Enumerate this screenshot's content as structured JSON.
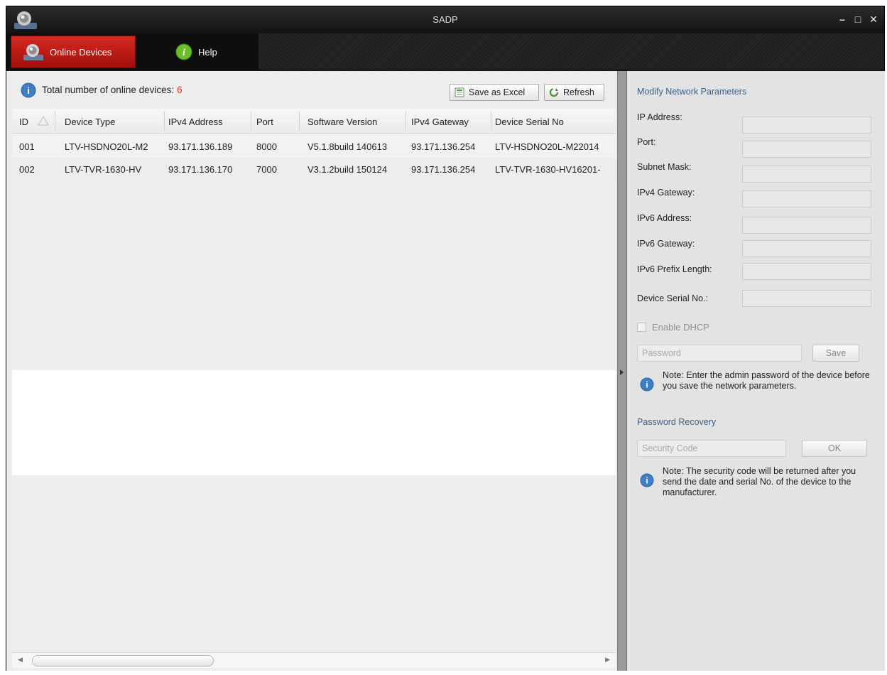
{
  "window": {
    "title": "SADP",
    "controls": {
      "minimize": "–",
      "maximize": "□",
      "close": "✕"
    }
  },
  "tabs": [
    {
      "label": "Online Devices",
      "icon": "camera-icon",
      "active": true
    },
    {
      "label": "Help",
      "icon": "info-icon",
      "active": false
    }
  ],
  "device_list": {
    "total_label": "Total number of online devices:",
    "total_count": "6",
    "buttons": {
      "save_excel": "Save as Excel",
      "refresh": "Refresh"
    },
    "columns": [
      "ID",
      "Device Type",
      "IPv4 Address",
      "Port",
      "Software Version",
      "IPv4 Gateway",
      "Device Serial No"
    ],
    "rows": [
      [
        "001",
        "LTV-HSDNO20L-M2",
        "93.171.136.189",
        "8000",
        "V5.1.8build 140613",
        "93.171.136.254",
        "LTV-HSDNO20L-M22014"
      ],
      [
        "002",
        "LTV-TVR-1630-HV",
        "93.171.136.170",
        "7000",
        "V3.1.2build 150124",
        "93.171.136.254",
        "LTV-TVR-1630-HV16201-"
      ]
    ]
  },
  "modify_panel": {
    "title": "Modify Network Parameters",
    "fields": [
      {
        "label": "IP Address:",
        "value": ""
      },
      {
        "label": "Port:",
        "value": ""
      },
      {
        "label": "Subnet Mask:",
        "value": ""
      },
      {
        "label": "IPv4 Gateway:",
        "value": ""
      },
      {
        "label": "IPv6 Address:",
        "value": ""
      },
      {
        "label": "IPv6 Gateway:",
        "value": ""
      },
      {
        "label": "IPv6 Prefix Length:",
        "value": ""
      },
      {
        "label": "Device Serial No.:",
        "value": ""
      }
    ],
    "dhcp_label": "Enable DHCP",
    "password_placeholder": "Password",
    "save_label": "Save",
    "save_note": "Note: Enter the admin password of the device before you save the network parameters."
  },
  "password_recovery": {
    "title": "Password Recovery",
    "security_code_placeholder": "Security Code",
    "ok_label": "OK",
    "note": "Note: The security code will be returned after you send the date and serial No. of the device to the manufacturer."
  },
  "colors": {
    "accent_red": "#c81e18",
    "count_red": "#d43a23",
    "section_blue": "#3b5f85",
    "info_blue": "#3f7fc4"
  }
}
